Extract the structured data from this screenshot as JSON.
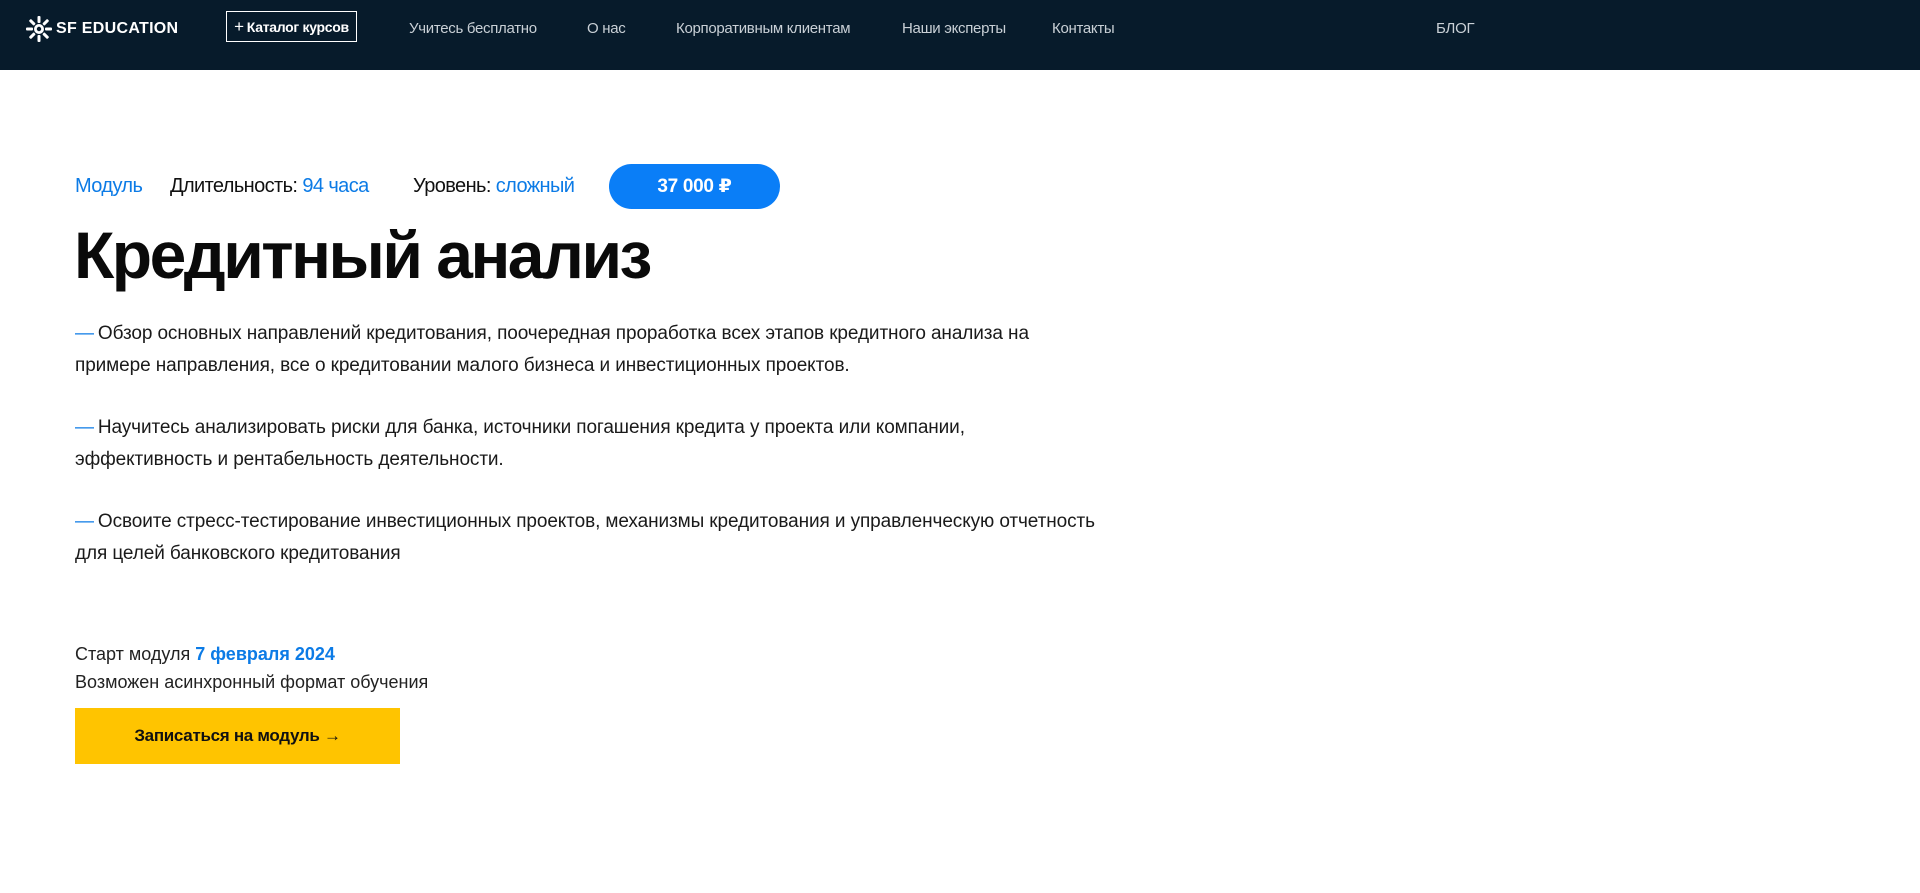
{
  "header": {
    "logo_text": "SF EDUCATION",
    "catalog_button": {
      "icon": "plus-icon",
      "label": "Каталог курсов"
    },
    "nav": [
      {
        "label": "Учитесь бесплатно"
      },
      {
        "label": "О нас"
      },
      {
        "label": "Корпоративным клиентам"
      },
      {
        "label": "Наши эксперты"
      },
      {
        "label": "Контакты"
      }
    ],
    "blog": "БЛОГ"
  },
  "course": {
    "type": "Модуль",
    "duration_label": "Длительность:",
    "duration_value": "94 часа",
    "level_label": "Уровень:",
    "level_value": "сложный",
    "price": "37 000 ₽",
    "title": "Кредитный анализ",
    "bullets": [
      {
        "dash": "—",
        "text": "Обзор основных направлений кредитования, поочередная проработка всех этапов кредитного анализа на примере направления, все о кредитовании малого бизнеса и инвестиционных проектов."
      },
      {
        "dash": "—",
        "text": "Научитесь анализировать риски для банка, источники погашения кредита у проекта или компании, эффективность и рентабельность деятельности."
      },
      {
        "dash": "—",
        "text": "Освоите стресс-тестирование инвестиционных проектов, механизмы кредитования и управленческую отчетность для целей банковского кредитования"
      }
    ],
    "start_label": "Старт модуля",
    "start_date": "7 февраля 2024",
    "async_note": "Возможен асинхронный формат обучения",
    "cta_label": "Записаться на модуль →"
  },
  "colors": {
    "header_bg": "#071b2b",
    "accent_blue": "#0c7be6",
    "price_bg": "#0a7ef7",
    "cta_bg": "#ffc400"
  }
}
